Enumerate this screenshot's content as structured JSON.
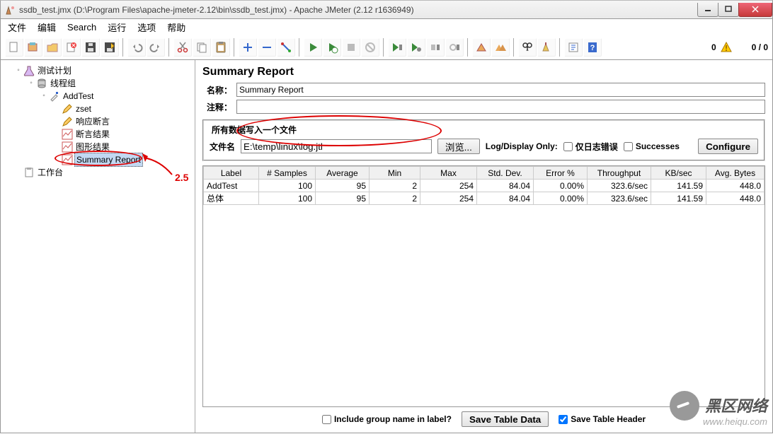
{
  "window": {
    "title": "ssdb_test.jmx (D:\\Program Files\\apache-jmeter-2.12\\bin\\ssdb_test.jmx) - Apache JMeter (2.12 r1636949)"
  },
  "menubar": {
    "file": "文件",
    "edit": "编辑",
    "search": "Search",
    "run": "运行",
    "options": "选项",
    "help": "帮助"
  },
  "toolbar": {
    "warn_count": "0",
    "err_frac": "0 / 0"
  },
  "tree": {
    "root": "测试计划",
    "thread_group": "线程组",
    "add_test": "AddTest",
    "zset": "zset",
    "resp_assert": "响应断言",
    "assert_result": "断言结果",
    "graph_result": "图形结果",
    "summary_report": "Summary Report",
    "workbench": "工作台"
  },
  "annotation": "2.5",
  "panel": {
    "heading": "Summary Report",
    "name_label": "名称：",
    "name_value": "Summary Report",
    "comment_label": "注释：",
    "comment_value": "",
    "file_legend": "所有数据写入一个文件",
    "filename_label": "文件名",
    "filename_value": "E:\\temp\\linux\\log.jtl",
    "browse": "浏览...",
    "log_display_only": "Log/Display Only:",
    "errors_only": "仅日志错误",
    "successes": "Successes",
    "configure": "Configure"
  },
  "table": {
    "headers": [
      "Label",
      "# Samples",
      "Average",
      "Min",
      "Max",
      "Std. Dev.",
      "Error %",
      "Throughput",
      "KB/sec",
      "Avg. Bytes"
    ],
    "rows": [
      {
        "label": "AddTest",
        "samples": "100",
        "avg": "95",
        "min": "2",
        "max": "254",
        "std": "84.04",
        "err": "0.00%",
        "thr": "323.6/sec",
        "kb": "141.59",
        "bytes": "448.0"
      },
      {
        "label": "总体",
        "samples": "100",
        "avg": "95",
        "min": "2",
        "max": "254",
        "std": "84.04",
        "err": "0.00%",
        "thr": "323.6/sec",
        "kb": "141.59",
        "bytes": "448.0"
      }
    ]
  },
  "bottom": {
    "include_group": "Include group name in label?",
    "save_data": "Save Table Data",
    "save_header": "Save Table Header"
  },
  "watermark": {
    "big": "黑区网络",
    "small": "www.heiqu.com"
  }
}
